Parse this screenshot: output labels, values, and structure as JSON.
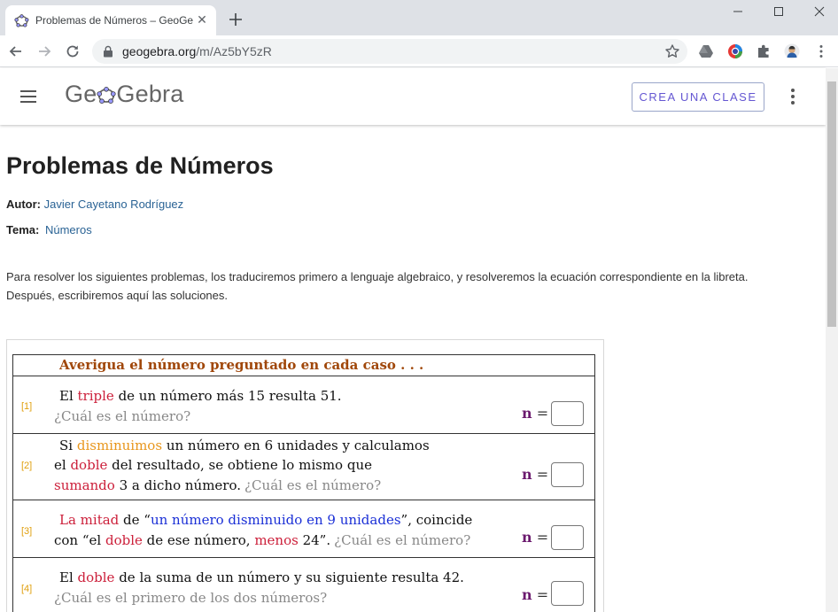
{
  "browser": {
    "tab_title": "Problemas de Números – GeoGe",
    "url_host": "geogebra.org",
    "url_path": "/m/Az5bY5zR"
  },
  "header": {
    "logo_text": "GeoGebra",
    "create_class_label": "CREA UNA CLASE"
  },
  "page": {
    "title": "Problemas de Números",
    "author_label": "Autor:",
    "author_name": "Javier Cayetano Rodríguez",
    "topic_label": "Tema:",
    "topic_name": "Números",
    "description_line1": "Para resolver los siguientes problemas, los traduciremos primero a lenguaje algebraico, y resolveremos la ecuación correspondiente en la libreta.",
    "description_line2": "Después, escribiremos aquí las soluciones."
  },
  "worksheet": {
    "heading": "Averigua el número preguntado en cada caso . . .",
    "answer_label_var": "n",
    "answer_label_eq": " =",
    "problems": [
      {
        "num": "[1]",
        "l1a": "El ",
        "l1b": "triple",
        "l1c": " de un número más 15 resulta 51.",
        "q": "¿Cuál es el número?"
      },
      {
        "num": "[2]",
        "l1a": "Si ",
        "l1b": "disminuimos",
        "l1c": " un número en 6 unidades y calculamos",
        "l2a": "el ",
        "l2b": "doble",
        "l2c": " del resultado, se obtiene lo mismo que",
        "l3a": "sumando",
        "l3b": " 3 a dicho número.",
        "q": "¿Cuál es el número?"
      },
      {
        "num": "[3]",
        "l1a": "La mitad",
        "l1b": " de “",
        "l1c": "un número disminuido en 9 unidades",
        "l1d": "”, coincide",
        "l2a": "con “el ",
        "l2b": "doble",
        "l2c": " de ese número, ",
        "l2d": "menos",
        "l2e": " 24”.",
        "q": "¿Cuál es el número?"
      },
      {
        "num": "[4]",
        "l1a": "El ",
        "l1b": "doble",
        "l1c": " de la suma de un número y su siguiente resulta 42.",
        "q": "¿Cuál es el primero de los dos números?"
      }
    ]
  }
}
